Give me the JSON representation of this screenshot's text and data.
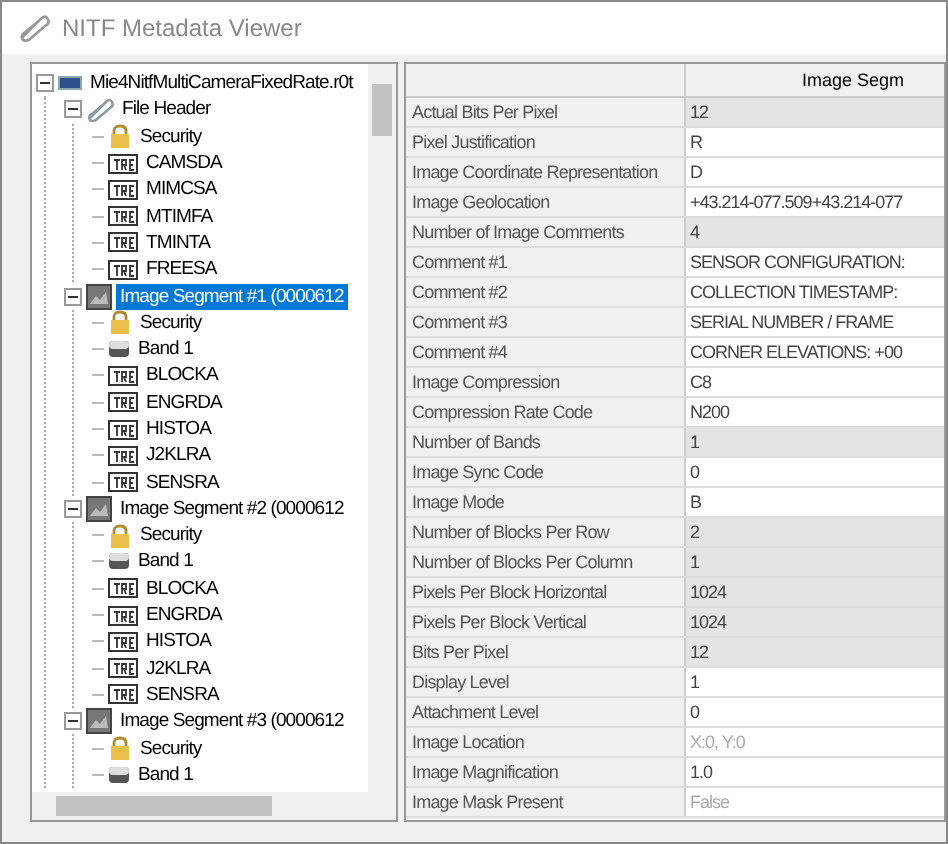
{
  "window": {
    "title": "NITF Metadata Viewer"
  },
  "tree": [
    {
      "label": "Mie4NitfMultiCameraFixedRate.r0t",
      "kind": "file",
      "expanded": true,
      "selected": false,
      "children": [
        {
          "label": "File Header",
          "kind": "header",
          "expanded": true,
          "selected": false,
          "children": [
            {
              "label": "Security",
              "kind": "security",
              "selected": false
            },
            {
              "label": "CAMSDA",
              "kind": "tre",
              "selected": false
            },
            {
              "label": "MIMCSA",
              "kind": "tre",
              "selected": false
            },
            {
              "label": "MTIMFA",
              "kind": "tre",
              "selected": false
            },
            {
              "label": "TMINTA",
              "kind": "tre",
              "selected": false
            },
            {
              "label": "FREESA",
              "kind": "tre",
              "selected": false
            }
          ]
        },
        {
          "label": "Image Segment #1 (0000612",
          "kind": "segment",
          "expanded": true,
          "selected": true,
          "children": [
            {
              "label": "Security",
              "kind": "security",
              "selected": false
            },
            {
              "label": "Band 1",
              "kind": "band",
              "selected": false
            },
            {
              "label": "BLOCKA",
              "kind": "tre",
              "selected": false
            },
            {
              "label": "ENGRDA",
              "kind": "tre",
              "selected": false
            },
            {
              "label": "HISTOA",
              "kind": "tre",
              "selected": false
            },
            {
              "label": "J2KLRA",
              "kind": "tre",
              "selected": false
            },
            {
              "label": "SENSRA",
              "kind": "tre",
              "selected": false
            }
          ]
        },
        {
          "label": "Image Segment #2 (0000612",
          "kind": "segment",
          "expanded": true,
          "selected": false,
          "children": [
            {
              "label": "Security",
              "kind": "security",
              "selected": false
            },
            {
              "label": "Band 1",
              "kind": "band",
              "selected": false
            },
            {
              "label": "BLOCKA",
              "kind": "tre",
              "selected": false
            },
            {
              "label": "ENGRDA",
              "kind": "tre",
              "selected": false
            },
            {
              "label": "HISTOA",
              "kind": "tre",
              "selected": false
            },
            {
              "label": "J2KLRA",
              "kind": "tre",
              "selected": false
            },
            {
              "label": "SENSRA",
              "kind": "tre",
              "selected": false
            }
          ]
        },
        {
          "label": "Image Segment #3 (0000612",
          "kind": "segment",
          "expanded": true,
          "selected": false,
          "children": [
            {
              "label": "Security",
              "kind": "security",
              "selected": false
            },
            {
              "label": "Band 1",
              "kind": "band",
              "selected": false
            }
          ]
        }
      ]
    }
  ],
  "grid": {
    "column_header": "Image Segm",
    "rows": [
      {
        "name": "Actual Bits Per Pixel",
        "value": "12",
        "editable": false,
        "disabled": false
      },
      {
        "name": "Pixel Justification",
        "value": "R",
        "editable": true,
        "disabled": false
      },
      {
        "name": "Image Coordinate Representation",
        "value": "D",
        "editable": true,
        "disabled": false
      },
      {
        "name": "Image Geolocation",
        "value": "+43.214-077.509+43.214-077",
        "editable": true,
        "disabled": false
      },
      {
        "name": "Number of Image Comments",
        "value": "4",
        "editable": false,
        "disabled": false
      },
      {
        "name": "Comment #1",
        "value": "SENSOR CONFIGURATION:",
        "editable": true,
        "disabled": false
      },
      {
        "name": "Comment #2",
        "value": "COLLECTION TIMESTAMP:",
        "editable": true,
        "disabled": false
      },
      {
        "name": "Comment #3",
        "value": "SERIAL NUMBER / FRAME",
        "editable": true,
        "disabled": false
      },
      {
        "name": "Comment #4",
        "value": "CORNER ELEVATIONS: +00",
        "editable": true,
        "disabled": false
      },
      {
        "name": "Image Compression",
        "value": "C8",
        "editable": true,
        "disabled": false
      },
      {
        "name": "Compression Rate Code",
        "value": "N200",
        "editable": true,
        "disabled": false
      },
      {
        "name": "Number of Bands",
        "value": "1",
        "editable": false,
        "disabled": false
      },
      {
        "name": "Image Sync Code",
        "value": "0",
        "editable": true,
        "disabled": false
      },
      {
        "name": "Image Mode",
        "value": "B",
        "editable": true,
        "disabled": false
      },
      {
        "name": "Number of Blocks Per Row",
        "value": "2",
        "editable": false,
        "disabled": false
      },
      {
        "name": "Number of Blocks Per Column",
        "value": "1",
        "editable": false,
        "disabled": false
      },
      {
        "name": "Pixels Per Block Horizontal",
        "value": "1024",
        "editable": false,
        "disabled": false
      },
      {
        "name": "Pixels Per Block Vertical",
        "value": "1024",
        "editable": false,
        "disabled": false
      },
      {
        "name": "Bits Per Pixel",
        "value": "12",
        "editable": false,
        "disabled": false
      },
      {
        "name": "Display Level",
        "value": "1",
        "editable": true,
        "disabled": false
      },
      {
        "name": "Attachment Level",
        "value": "0",
        "editable": true,
        "disabled": false
      },
      {
        "name": "Image Location",
        "value": "X:0, Y:0",
        "editable": true,
        "disabled": true
      },
      {
        "name": "Image Magnification",
        "value": "1.0",
        "editable": true,
        "disabled": false
      },
      {
        "name": "Image Mask Present",
        "value": "False",
        "editable": true,
        "disabled": true
      }
    ]
  }
}
